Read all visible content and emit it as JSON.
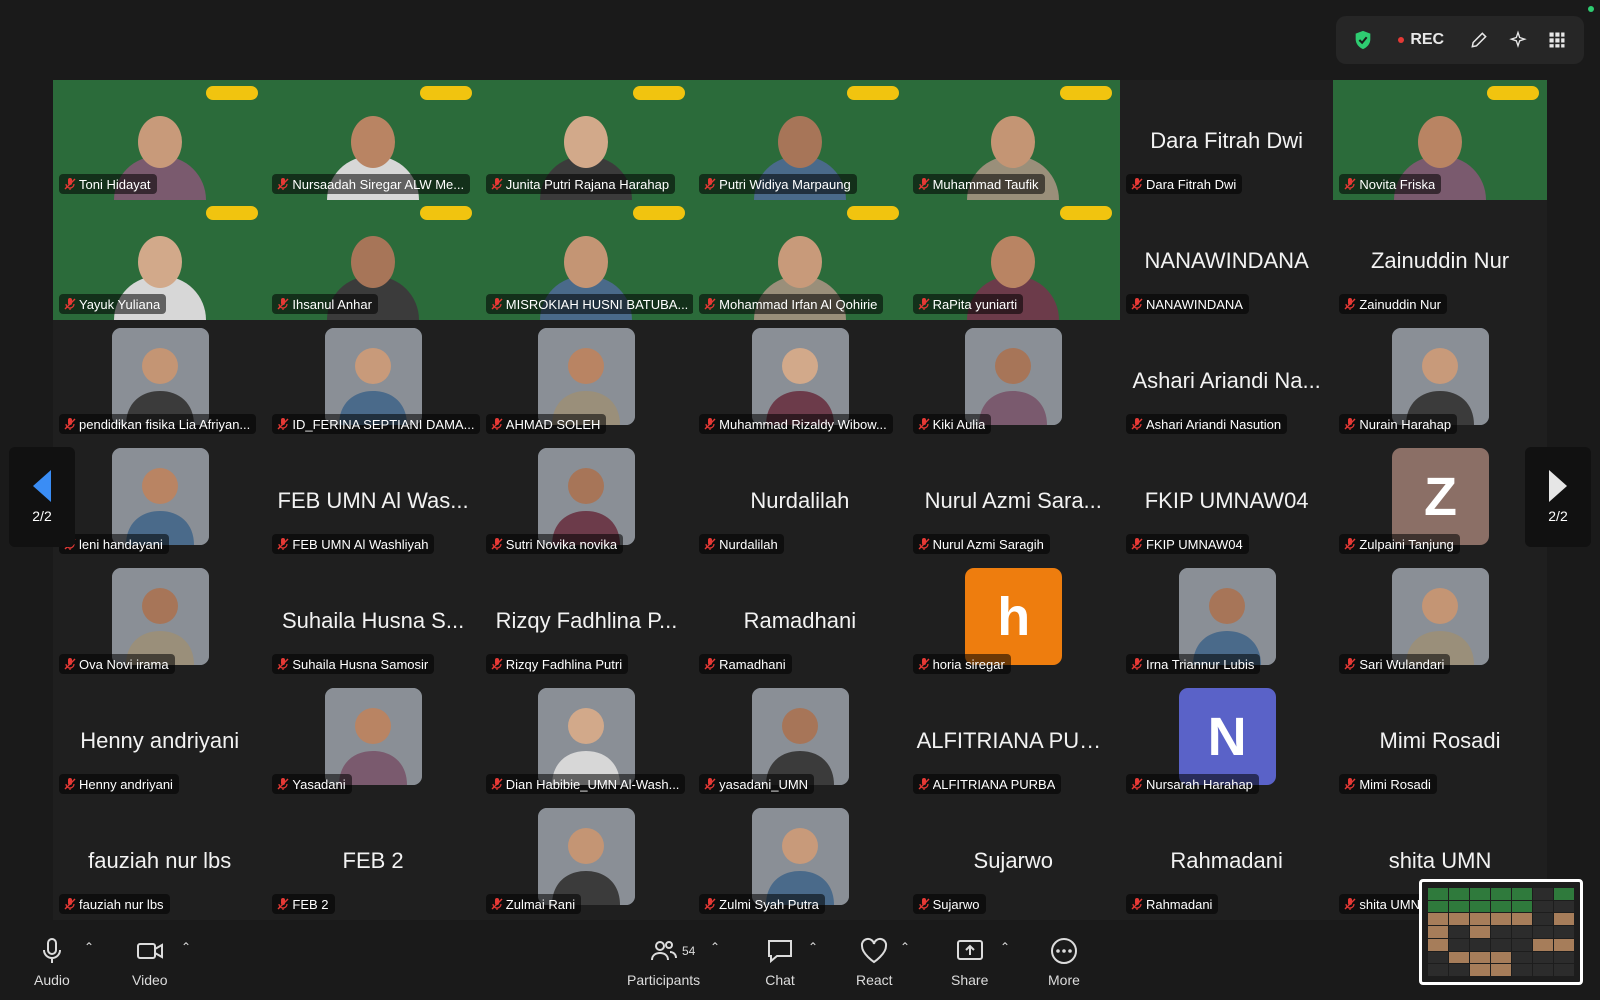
{
  "topbar": {
    "rec_label": "REC",
    "icons": [
      "shield-check-icon",
      "pencil-icon",
      "sparkle-icon",
      "apps-grid-icon"
    ]
  },
  "navigation": {
    "page_left": "2/2",
    "page_right": "2/2"
  },
  "tiles": [
    {
      "label": "Toni Hidayat",
      "kind": "video"
    },
    {
      "label": "Nursaadah Siregar ALW Me...",
      "kind": "video"
    },
    {
      "label": "Junita Putri Rajana Harahap",
      "kind": "video"
    },
    {
      "label": "Putri Widiya Marpaung",
      "kind": "video"
    },
    {
      "label": "Muhammad Taufik",
      "kind": "video"
    },
    {
      "label": "Dara Fitrah Dwi",
      "kind": "name",
      "big": "Dara Fitrah Dwi"
    },
    {
      "label": "Novita Friska",
      "kind": "video"
    },
    {
      "label": "Yayuk Yuliana",
      "kind": "video"
    },
    {
      "label": "Ihsanul Anhar",
      "kind": "video"
    },
    {
      "label": "MISROKIAH HUSNI BATUBA...",
      "kind": "video"
    },
    {
      "label": "Mohammad Irfan Al Qohirie",
      "kind": "video"
    },
    {
      "label": "RaPita yuniarti",
      "kind": "video"
    },
    {
      "label": "NANAWINDANA",
      "kind": "name",
      "big": "NANAWINDANA"
    },
    {
      "label": "Zainuddin Nur",
      "kind": "name",
      "big": "Zainuddin Nur"
    },
    {
      "label": "pendidikan fisika Lia Afriyan...",
      "kind": "avatar"
    },
    {
      "label": "ID_FERINA SEPTIANI DAMA...",
      "kind": "avatar"
    },
    {
      "label": "AHMAD SOLEH",
      "kind": "avatar"
    },
    {
      "label": "Muhammad Rizaldy Wibow...",
      "kind": "avatar"
    },
    {
      "label": "Kiki Aulia",
      "kind": "avatar"
    },
    {
      "label": "Ashari Ariandi Nasution",
      "kind": "name",
      "big": "Ashari Ariandi Na..."
    },
    {
      "label": "Nurain Harahap",
      "kind": "avatar"
    },
    {
      "label": "leni handayani",
      "kind": "avatar"
    },
    {
      "label": "FEB UMN Al Washliyah",
      "kind": "name",
      "big": "FEB UMN Al Was..."
    },
    {
      "label": "Sutri Novika novika",
      "kind": "avatar"
    },
    {
      "label": "Nurdalilah",
      "kind": "name",
      "big": "Nurdalilah"
    },
    {
      "label": "Nurul Azmi Saragih",
      "kind": "name",
      "big": "Nurul Azmi Sara..."
    },
    {
      "label": "FKIP UMNAW04",
      "kind": "name",
      "big": "FKIP UMNAW04"
    },
    {
      "label": "Zulpaini Tanjung",
      "kind": "letter",
      "letter": "Z",
      "color": "#8b6f66"
    },
    {
      "label": "Ova Novi irama",
      "kind": "avatar"
    },
    {
      "label": "Suhaila Husna Samosir",
      "kind": "name",
      "big": "Suhaila Husna S..."
    },
    {
      "label": "Rizqy Fadhlina Putri",
      "kind": "name",
      "big": "Rizqy Fadhlina P..."
    },
    {
      "label": "Ramadhani",
      "kind": "name",
      "big": "Ramadhani"
    },
    {
      "label": "horia siregar",
      "kind": "letter",
      "letter": "h",
      "color": "#ee7d0e"
    },
    {
      "label": "Irna Triannur Lubis",
      "kind": "avatar"
    },
    {
      "label": "Sari Wulandari",
      "kind": "avatar"
    },
    {
      "label": "Henny andriyani",
      "kind": "name",
      "big": "Henny andriyani"
    },
    {
      "label": "Yasadani",
      "kind": "avatar"
    },
    {
      "label": "Dian Habibie_UMN Al-Wash...",
      "kind": "avatar"
    },
    {
      "label": "yasadani_UMN",
      "kind": "avatar"
    },
    {
      "label": "ALFITRIANA PURBA",
      "kind": "name",
      "big": "ALFITRIANA PUR..."
    },
    {
      "label": "Nursarah Harahap",
      "kind": "letter",
      "letter": "N",
      "color": "#5a62c8"
    },
    {
      "label": "Mimi Rosadi",
      "kind": "name",
      "big": "Mimi Rosadi"
    },
    {
      "label": "fauziah nur lbs",
      "kind": "name",
      "big": "fauziah nur lbs"
    },
    {
      "label": "FEB 2",
      "kind": "name",
      "big": "FEB 2"
    },
    {
      "label": "Zulmai Rani",
      "kind": "avatar"
    },
    {
      "label": "Zulmi Syah Putra",
      "kind": "avatar"
    },
    {
      "label": "Sujarwo",
      "kind": "name",
      "big": "Sujarwo"
    },
    {
      "label": "Rahmadani",
      "kind": "name",
      "big": "Rahmadani"
    },
    {
      "label": "shita UMN",
      "kind": "name",
      "big": "shita UMN"
    }
  ],
  "toolbar": {
    "audio": "Audio",
    "video": "Video",
    "participants": "Participants",
    "participants_count": "54",
    "chat": "Chat",
    "react": "React",
    "share": "Share",
    "more": "More"
  },
  "colors": {
    "accent": "#3a8df5",
    "shield": "#2ecc71",
    "rec": "#e53935",
    "tile_bg": "#1f1f1f",
    "video_bg": "#2b6b3a"
  }
}
